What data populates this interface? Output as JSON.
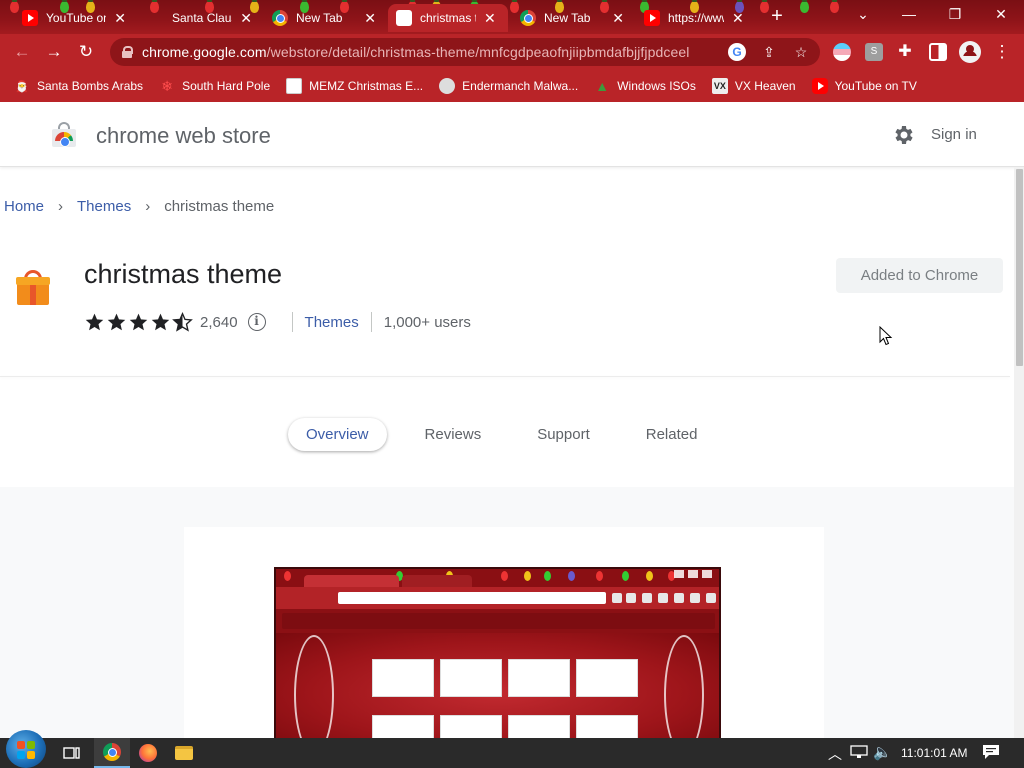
{
  "browser": {
    "tabs": [
      {
        "title": "YouTube on TV",
        "favicon": "youtube-icon"
      },
      {
        "title": "Santa Claus",
        "favicon": "santa-icon"
      },
      {
        "title": "New Tab",
        "favicon": "chrome-icon"
      },
      {
        "title": "christmas theme",
        "favicon": "web-store-icon",
        "active": true
      },
      {
        "title": "New Tab",
        "favicon": "chrome-icon"
      },
      {
        "title": "https://www.youtube.com",
        "favicon": "youtube-icon"
      }
    ],
    "new_tab_label": "+",
    "url_host": "chrome.google.com",
    "url_path": "/webstore/detail/christmas-theme/mnfcgdpeaofnjiipbmdafbjjfjpdceel",
    "bookmarks": [
      {
        "label": "Santa Bombs Arabs",
        "icon": "santa-icon"
      },
      {
        "label": "South Hard Pole",
        "icon": "snowflake-icon"
      },
      {
        "label": "MEMZ Christmas E...",
        "icon": "page-icon"
      },
      {
        "label": "Endermanch Malwa...",
        "icon": "raccoon-icon"
      },
      {
        "label": "Windows ISOs",
        "icon": "tree-icon"
      },
      {
        "label": "VX Heaven",
        "icon": "vx-icon"
      },
      {
        "label": "YouTube on TV",
        "icon": "youtube-icon"
      }
    ],
    "theme_colors": {
      "frame": "#8f1419",
      "toolbar": "#b92428",
      "omnibox": "#8e1519"
    }
  },
  "store": {
    "title": "chrome web store",
    "sign_in": "Sign in",
    "breadcrumb": {
      "home": "Home",
      "themes": "Themes",
      "current": "christmas theme"
    },
    "item": {
      "name": "christmas theme",
      "rating": 4.5,
      "rating_count": "2,640",
      "category": "Themes",
      "users": "1,000+ users",
      "action_label": "Added to Chrome"
    },
    "tabs": [
      "Overview",
      "Reviews",
      "Support",
      "Related"
    ],
    "active_tab": "Overview",
    "link_color": "#3c5da8"
  },
  "taskbar": {
    "clock": "11:01:01 AM",
    "apps": [
      "task-view-icon",
      "chrome-icon",
      "firefox-icon",
      "file-explorer-icon"
    ]
  }
}
